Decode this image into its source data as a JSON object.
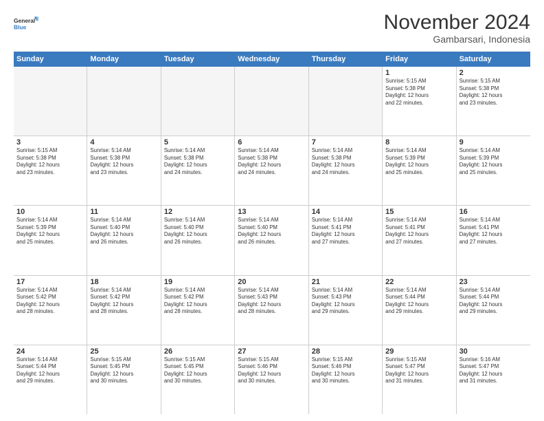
{
  "logo": {
    "line1": "General",
    "line2": "Blue"
  },
  "title": "November 2024",
  "subtitle": "Gambarsari, Indonesia",
  "days": [
    "Sunday",
    "Monday",
    "Tuesday",
    "Wednesday",
    "Thursday",
    "Friday",
    "Saturday"
  ],
  "weeks": [
    [
      {
        "day": "",
        "empty": true
      },
      {
        "day": "",
        "empty": true
      },
      {
        "day": "",
        "empty": true
      },
      {
        "day": "",
        "empty": true
      },
      {
        "day": "",
        "empty": true
      },
      {
        "day": "1",
        "detail": "Sunrise: 5:15 AM\nSunset: 5:38 PM\nDaylight: 12 hours\nand 22 minutes."
      },
      {
        "day": "2",
        "detail": "Sunrise: 5:15 AM\nSunset: 5:38 PM\nDaylight: 12 hours\nand 23 minutes."
      }
    ],
    [
      {
        "day": "3",
        "detail": "Sunrise: 5:15 AM\nSunset: 5:38 PM\nDaylight: 12 hours\nand 23 minutes."
      },
      {
        "day": "4",
        "detail": "Sunrise: 5:14 AM\nSunset: 5:38 PM\nDaylight: 12 hours\nand 23 minutes."
      },
      {
        "day": "5",
        "detail": "Sunrise: 5:14 AM\nSunset: 5:38 PM\nDaylight: 12 hours\nand 24 minutes."
      },
      {
        "day": "6",
        "detail": "Sunrise: 5:14 AM\nSunset: 5:38 PM\nDaylight: 12 hours\nand 24 minutes."
      },
      {
        "day": "7",
        "detail": "Sunrise: 5:14 AM\nSunset: 5:38 PM\nDaylight: 12 hours\nand 24 minutes."
      },
      {
        "day": "8",
        "detail": "Sunrise: 5:14 AM\nSunset: 5:39 PM\nDaylight: 12 hours\nand 25 minutes."
      },
      {
        "day": "9",
        "detail": "Sunrise: 5:14 AM\nSunset: 5:39 PM\nDaylight: 12 hours\nand 25 minutes."
      }
    ],
    [
      {
        "day": "10",
        "detail": "Sunrise: 5:14 AM\nSunset: 5:39 PM\nDaylight: 12 hours\nand 25 minutes."
      },
      {
        "day": "11",
        "detail": "Sunrise: 5:14 AM\nSunset: 5:40 PM\nDaylight: 12 hours\nand 26 minutes."
      },
      {
        "day": "12",
        "detail": "Sunrise: 5:14 AM\nSunset: 5:40 PM\nDaylight: 12 hours\nand 26 minutes."
      },
      {
        "day": "13",
        "detail": "Sunrise: 5:14 AM\nSunset: 5:40 PM\nDaylight: 12 hours\nand 26 minutes."
      },
      {
        "day": "14",
        "detail": "Sunrise: 5:14 AM\nSunset: 5:41 PM\nDaylight: 12 hours\nand 27 minutes."
      },
      {
        "day": "15",
        "detail": "Sunrise: 5:14 AM\nSunset: 5:41 PM\nDaylight: 12 hours\nand 27 minutes."
      },
      {
        "day": "16",
        "detail": "Sunrise: 5:14 AM\nSunset: 5:41 PM\nDaylight: 12 hours\nand 27 minutes."
      }
    ],
    [
      {
        "day": "17",
        "detail": "Sunrise: 5:14 AM\nSunset: 5:42 PM\nDaylight: 12 hours\nand 28 minutes."
      },
      {
        "day": "18",
        "detail": "Sunrise: 5:14 AM\nSunset: 5:42 PM\nDaylight: 12 hours\nand 28 minutes."
      },
      {
        "day": "19",
        "detail": "Sunrise: 5:14 AM\nSunset: 5:42 PM\nDaylight: 12 hours\nand 28 minutes."
      },
      {
        "day": "20",
        "detail": "Sunrise: 5:14 AM\nSunset: 5:43 PM\nDaylight: 12 hours\nand 28 minutes."
      },
      {
        "day": "21",
        "detail": "Sunrise: 5:14 AM\nSunset: 5:43 PM\nDaylight: 12 hours\nand 29 minutes."
      },
      {
        "day": "22",
        "detail": "Sunrise: 5:14 AM\nSunset: 5:44 PM\nDaylight: 12 hours\nand 29 minutes."
      },
      {
        "day": "23",
        "detail": "Sunrise: 5:14 AM\nSunset: 5:44 PM\nDaylight: 12 hours\nand 29 minutes."
      }
    ],
    [
      {
        "day": "24",
        "detail": "Sunrise: 5:14 AM\nSunset: 5:44 PM\nDaylight: 12 hours\nand 29 minutes."
      },
      {
        "day": "25",
        "detail": "Sunrise: 5:15 AM\nSunset: 5:45 PM\nDaylight: 12 hours\nand 30 minutes."
      },
      {
        "day": "26",
        "detail": "Sunrise: 5:15 AM\nSunset: 5:45 PM\nDaylight: 12 hours\nand 30 minutes."
      },
      {
        "day": "27",
        "detail": "Sunrise: 5:15 AM\nSunset: 5:46 PM\nDaylight: 12 hours\nand 30 minutes."
      },
      {
        "day": "28",
        "detail": "Sunrise: 5:15 AM\nSunset: 5:46 PM\nDaylight: 12 hours\nand 30 minutes."
      },
      {
        "day": "29",
        "detail": "Sunrise: 5:15 AM\nSunset: 5:47 PM\nDaylight: 12 hours\nand 31 minutes."
      },
      {
        "day": "30",
        "detail": "Sunrise: 5:16 AM\nSunset: 5:47 PM\nDaylight: 12 hours\nand 31 minutes."
      }
    ]
  ]
}
